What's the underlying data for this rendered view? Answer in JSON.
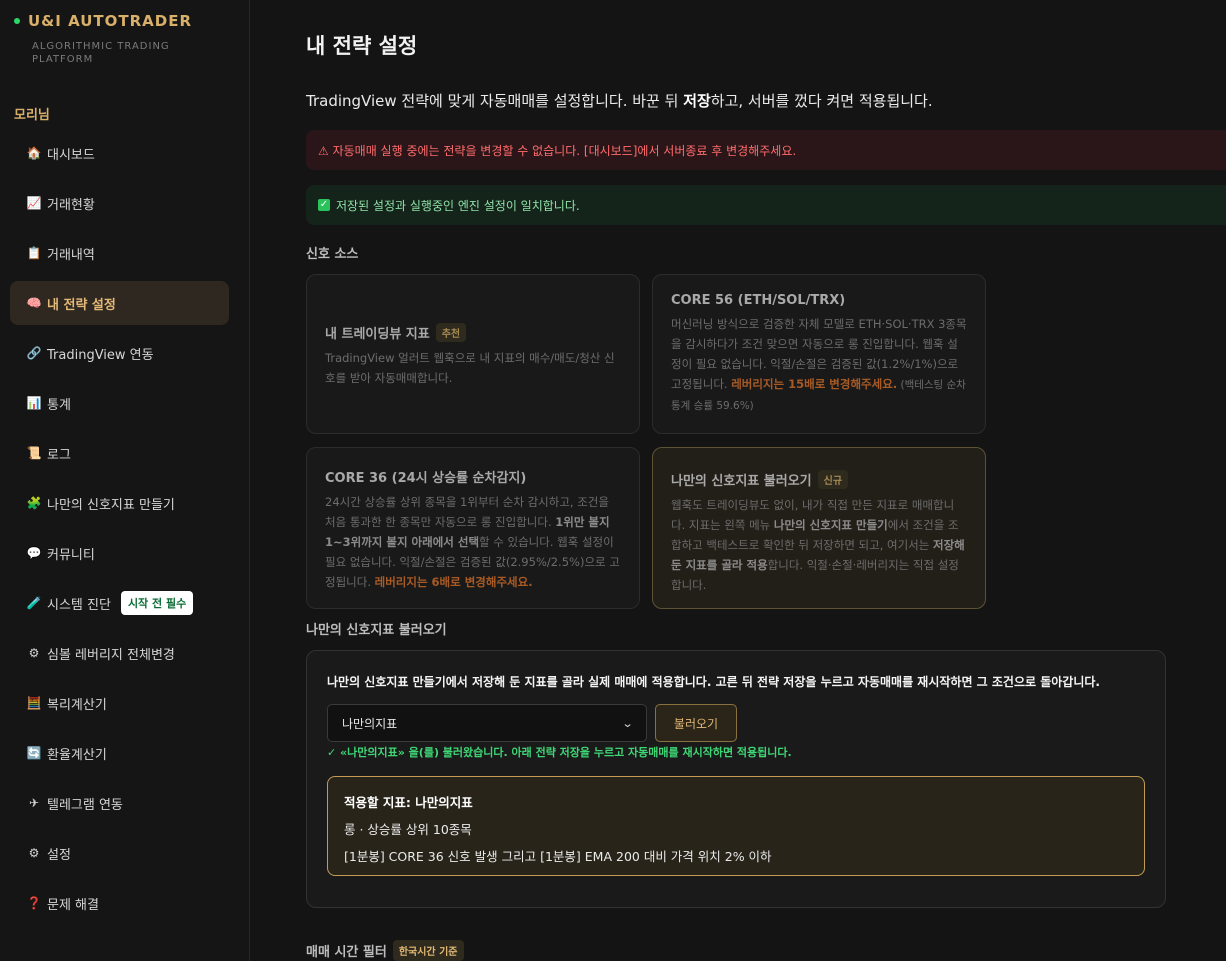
{
  "brand": {
    "title": "U&I AUTOTRADER",
    "subtitle": "ALGORITHMIC TRADING PLATFORM"
  },
  "user": {
    "name": "모리님"
  },
  "sidebar": {
    "items": [
      {
        "icon": "🏠",
        "icon_name": "home-icon",
        "label": "대시보드"
      },
      {
        "icon": "📈",
        "icon_name": "chart-up-icon",
        "label": "거래현황"
      },
      {
        "icon": "📋",
        "icon_name": "clipboard-icon",
        "label": "거래내역"
      },
      {
        "icon": "🧠",
        "icon_name": "brain-icon",
        "label": "내 전략 설정",
        "active": true
      },
      {
        "icon": "🔗",
        "icon_name": "link-icon",
        "label": "TradingView 연동"
      },
      {
        "icon": "📊",
        "icon_name": "bar-chart-icon",
        "label": "통계"
      },
      {
        "icon": "📜",
        "icon_name": "scroll-icon",
        "label": "로그"
      },
      {
        "icon": "🧩",
        "icon_name": "puzzle-icon",
        "label": "나만의 신호지표 만들기"
      },
      {
        "icon": "💬",
        "icon_name": "chat-icon",
        "label": "커뮤니티"
      },
      {
        "icon": "🧪",
        "icon_name": "test-tube-icon",
        "label": "시스템 진단",
        "badge": "시작 전 필수"
      },
      {
        "icon": "⚙",
        "icon_name": "gear-icon",
        "label": "심볼 레버리지 전체변경"
      },
      {
        "icon": "🧮",
        "icon_name": "abacus-icon",
        "label": "복리계산기"
      },
      {
        "icon": "🔄",
        "icon_name": "exchange-icon",
        "label": "환율계산기"
      },
      {
        "icon": "✈",
        "icon_name": "telegram-icon",
        "label": "텔레그램 연동"
      },
      {
        "icon": "⚙",
        "icon_name": "settings-icon",
        "label": "설정"
      },
      {
        "icon": "❓",
        "icon_name": "question-icon",
        "label": "문제 해결"
      }
    ]
  },
  "page": {
    "title": "내 전략 설정",
    "desc_pre": "TradingView 전략에 맞게 자동매매를 설정합니다. 바꾼 뒤 ",
    "desc_bold": "저장",
    "desc_post": "하고, 서버를 껐다 켜면 적용됩니다."
  },
  "alerts": {
    "error": "⚠ 자동매매 실행 중에는 전략을 변경할 수 없습니다. [대시보드]에서 서버종료 후 변경해주세요.",
    "ok": "저장된 설정과 실행중인 엔진 설정이 일치합니다."
  },
  "signal_source": {
    "label": "신호 소스",
    "cards": [
      {
        "title": "내 트레이딩뷰 지표",
        "tag": "추천",
        "desc": "TradingView 얼러트 웹훅으로 내 지표의 매수/매도/청산 신호를 받아 자동매매합니다."
      },
      {
        "title": "CORE 56 (ETH/SOL/TRX)",
        "desc": "머신러닝 방식으로 검증한 자체 모델로 ETH·SOL·TRX 3종목을 감시하다가 조건 맞으면 자동으로 롱 진입합니다. 웹훅 설정이 필요 없습니다. 익절/손절은 검증된 값(1.2%/1%)으로 고정됩니다. ",
        "highlight": "레버리지는 15배로 변경해주세요.",
        "small": " (백테스팅 순차 통계 승률 59.6%)"
      },
      {
        "title": "CORE 36 (24시 상승률 순차감지)",
        "desc_pre": "24시간 상승률 상위 종목을 1위부터 순차 감시하고, 조건을 처음 통과한 한 종목만 자동으로 롱 진입합니다. ",
        "desc_bold": "1위만 볼지 1~3위까지 볼지 아래에서 선택",
        "desc_post": "할 수 있습니다. 웹훅 설정이 필요 없습니다. 익절/손절은 검증된 값(2.95%/2.5%)으로 고정됩니다. ",
        "highlight": "레버리지는 6배로 변경해주세요."
      },
      {
        "title": "나만의 신호지표 불러오기",
        "tag": "신규",
        "desc_pre": "웹훅도 트레이딩뷰도 없이, 내가 직접 만든 지표로 매매합니다. 지표는 왼쪽 메뉴 ",
        "desc_bold1": "나만의 신호지표 만들기",
        "desc_mid": "에서 조건을 조합하고 백테스트로 확인한 뒤 저장하면 되고, 여기서는 ",
        "desc_bold2": "저장해 둔 지표를 골라 적용",
        "desc_post": "합니다. 익절·손절·레버리지는 직접 설정합니다."
      }
    ]
  },
  "custom_signal": {
    "label": "나만의 신호지표 불러오기",
    "intro": "나만의 신호지표 만들기에서 저장해 둔 지표를 골라 실제 매매에 적용합니다. 고른 뒤 전략 저장을 누르고 자동매매를 재시작하면 그 조건으로 돌아갑니다.",
    "selected": "나만의지표",
    "load_button": "불러오기",
    "success": "✓ «나만의지표» 을(를) 불러왔습니다. 아래 전략 저장을 누르고 자동매매를 재시작하면 적용됩니다.",
    "applied_title": "적용할 지표: 나만의지표",
    "applied_line1": "롱 · 상승률 상위 10종목",
    "applied_line2": "[1분봉] CORE 36 신호 발생 그리고 [1분봉] EMA 200 대비 가격 위치 2% 이하"
  },
  "time_filter": {
    "label": "매매 시간 필터",
    "tag": "한국시간 기준"
  }
}
